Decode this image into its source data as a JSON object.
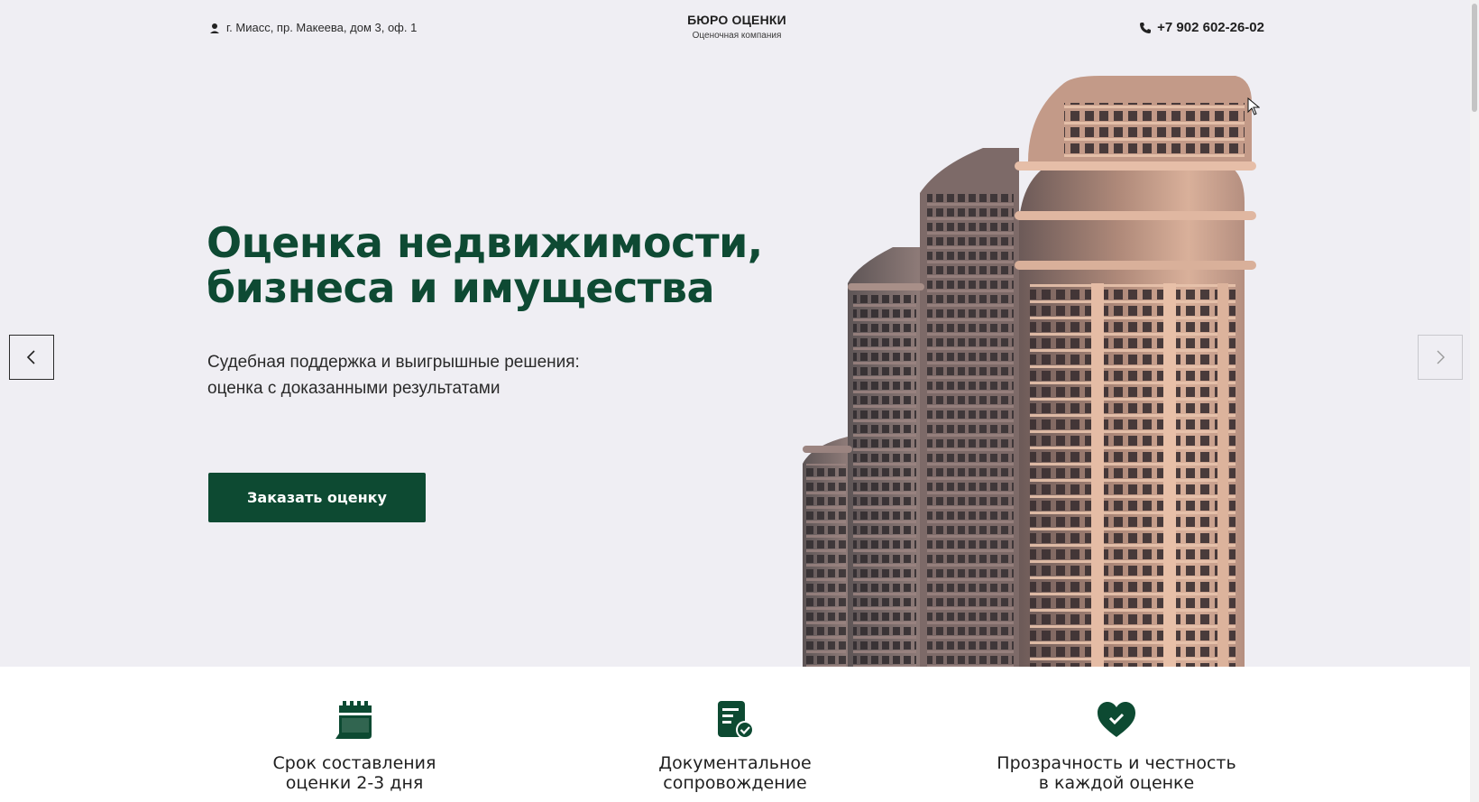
{
  "header": {
    "address": "г. Миасс, пр. Макеева, дом 3, оф. 1",
    "brand_title": "БЮРО ОЦЕНКИ",
    "brand_subtitle": "Оценочная компания",
    "phone": "+7 902 602-26-02"
  },
  "hero": {
    "title_line1": "Оценка недвижимости,",
    "title_line2": "бизнеса и имущества",
    "subtitle_line1": "Судебная поддержка и выигрышные решения:",
    "subtitle_line2": "оценка с доказанными результатами",
    "cta_label": "Заказать оценку"
  },
  "features": [
    {
      "icon": "calendar-icon",
      "line1": "Срок составления",
      "line2": "оценки 2-3 дня"
    },
    {
      "icon": "document-check-icon",
      "line1": "Документальное",
      "line2": "сопровождение"
    },
    {
      "icon": "heart-check-icon",
      "line1": "Прозрачность и честность",
      "line2": "в каждой оценке"
    }
  ],
  "colors": {
    "accent": "#0d4a32",
    "background": "#efeef3",
    "features_bg": "#ffffff"
  }
}
